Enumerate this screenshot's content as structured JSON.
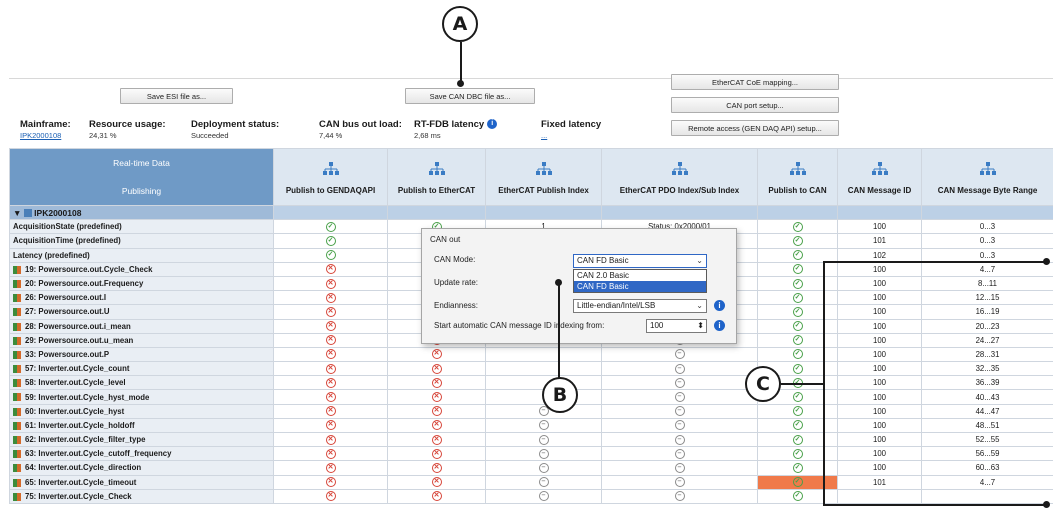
{
  "callouts": {
    "a": "A",
    "b": "B",
    "c": "C"
  },
  "toolbar": {
    "save_esi": "Save ESI file as...",
    "save_dbc": "Save CAN DBC file as...",
    "ethercat_coe": "EtherCAT CoE mapping...",
    "can_port": "CAN port setup...",
    "remote_access": "Remote access (GEN DAQ API) setup..."
  },
  "info": {
    "mainframe_label": "Mainframe:",
    "mainframe_value": "IPK2000108",
    "resource_label": "Resource usage:",
    "resource_value": "24,31 %",
    "deploy_label": "Deployment status:",
    "deploy_value": "Succeeded",
    "canload_label": "CAN bus out load:",
    "canload_value": "7,44 %",
    "rtfdb_label": "RT-FDB latency",
    "rtfdb_value": "2,68 ms",
    "fixed_label": "Fixed latency",
    "fixed_value": "..."
  },
  "columns": {
    "rt_line1": "Real-time Data",
    "rt_line2": "Publishing",
    "c1": "Publish to GENDAQAPI",
    "c2": "Publish to EtherCAT",
    "c3": "EtherCAT Publish Index",
    "c4": "EtherCAT PDO Index/Sub Index",
    "c5": "Publish to CAN",
    "c6": "CAN Message ID",
    "c7": "CAN Message Byte Range"
  },
  "group": "IPK2000108",
  "rows": [
    {
      "name": "AcquisitionState (predefined)",
      "chan": false,
      "gen": "ok",
      "ecat": "ok",
      "idx": "1",
      "pdo": "Status: 0x2000/01",
      "can": "ok",
      "id": "100",
      "range": "0...3"
    },
    {
      "name": "AcquisitionTime (predefined)",
      "chan": false,
      "gen": "ok",
      "ecat": "",
      "idx": "",
      "pdo": "",
      "can": "ok",
      "id": "101",
      "range": "0...3"
    },
    {
      "name": "Latency (predefined)",
      "chan": false,
      "gen": "ok",
      "ecat": "",
      "idx": "",
      "pdo": "02",
      "can": "ok",
      "id": "102",
      "range": "0...3"
    },
    {
      "name": "19: Powersource.out.Cycle_Check",
      "chan": true,
      "gen": "no",
      "ecat": "",
      "idx": "",
      "pdo": "",
      "can": "ok",
      "id": "100",
      "range": "4...7"
    },
    {
      "name": "20: Powersource.out.Frequency",
      "chan": true,
      "gen": "no",
      "ecat": "",
      "idx": "",
      "pdo": "",
      "can": "ok",
      "id": "100",
      "range": "8...11"
    },
    {
      "name": "26: Powersource.out.I",
      "chan": true,
      "gen": "no",
      "ecat": "",
      "idx": "",
      "pdo": "",
      "can": "ok",
      "id": "100",
      "range": "12...15"
    },
    {
      "name": "27: Powersource.out.U",
      "chan": true,
      "gen": "no",
      "ecat": "",
      "idx": "",
      "pdo": "",
      "can": "ok",
      "id": "100",
      "range": "16...19"
    },
    {
      "name": "28: Powersource.out.i_mean",
      "chan": true,
      "gen": "no",
      "ecat": "",
      "idx": "",
      "pdo": "",
      "can": "ok",
      "id": "100",
      "range": "20...23"
    },
    {
      "name": "29: Powersource.out.u_mean",
      "chan": true,
      "gen": "no",
      "ecat": "no",
      "idx": "",
      "pdo": "na",
      "can": "ok",
      "id": "100",
      "range": "24...27"
    },
    {
      "name": "33: Powersource.out.P",
      "chan": true,
      "gen": "no",
      "ecat": "no",
      "idx": "",
      "pdo": "na",
      "can": "ok",
      "id": "100",
      "range": "28...31"
    },
    {
      "name": "57: Inverter.out.Cycle_count",
      "chan": true,
      "gen": "no",
      "ecat": "no",
      "idx": "",
      "pdo": "na",
      "can": "ok",
      "id": "100",
      "range": "32...35"
    },
    {
      "name": "58: Inverter.out.Cycle_level",
      "chan": true,
      "gen": "no",
      "ecat": "no",
      "idx": "",
      "pdo": "na",
      "can": "ok",
      "id": "100",
      "range": "36...39"
    },
    {
      "name": "59: Inverter.out.Cycle_hyst_mode",
      "chan": true,
      "gen": "no",
      "ecat": "no",
      "idx": "",
      "pdo": "na",
      "can": "ok",
      "id": "100",
      "range": "40...43"
    },
    {
      "name": "60: Inverter.out.Cycle_hyst",
      "chan": true,
      "gen": "no",
      "ecat": "no",
      "idx": "na",
      "pdo": "na",
      "can": "ok",
      "id": "100",
      "range": "44...47"
    },
    {
      "name": "61: Inverter.out.Cycle_holdoff",
      "chan": true,
      "gen": "no",
      "ecat": "no",
      "idx": "na",
      "pdo": "na",
      "can": "ok",
      "id": "100",
      "range": "48...51"
    },
    {
      "name": "62: Inverter.out.Cycle_filter_type",
      "chan": true,
      "gen": "no",
      "ecat": "no",
      "idx": "na",
      "pdo": "na",
      "can": "ok",
      "id": "100",
      "range": "52...55"
    },
    {
      "name": "63: Inverter.out.Cycle_cutoff_frequency",
      "chan": true,
      "gen": "no",
      "ecat": "no",
      "idx": "na",
      "pdo": "na",
      "can": "ok",
      "id": "100",
      "range": "56...59"
    },
    {
      "name": "64: Inverter.out.Cycle_direction",
      "chan": true,
      "gen": "no",
      "ecat": "no",
      "idx": "na",
      "pdo": "na",
      "can": "ok",
      "id": "100",
      "range": "60...63"
    },
    {
      "name": "65: Inverter.out.Cycle_timeout",
      "chan": true,
      "gen": "no",
      "ecat": "no",
      "idx": "na",
      "pdo": "na",
      "can": "ok-orange",
      "id": "101",
      "range": "4...7"
    },
    {
      "name": "75: Inverter.out.Cycle_Check",
      "chan": true,
      "gen": "no",
      "ecat": "no",
      "idx": "na",
      "pdo": "na",
      "can": "ok",
      "id": "",
      "range": ""
    }
  ],
  "popup": {
    "title": "CAN out",
    "mode_label": "CAN Mode:",
    "mode_value": "CAN FD Basic",
    "options": [
      "CAN 2.0 Basic",
      "CAN FD Basic"
    ],
    "update_label": "Update rate:",
    "endian_label": "Endianness:",
    "endian_value": "Little-endian/Intel/LSB",
    "start_label": "Start automatic CAN message ID indexing from:",
    "start_value": "100"
  },
  "colors": {
    "header": "#6f9ac6",
    "ok": "#49a049",
    "error": "#d7463a",
    "highlight": "#f07a4a"
  }
}
